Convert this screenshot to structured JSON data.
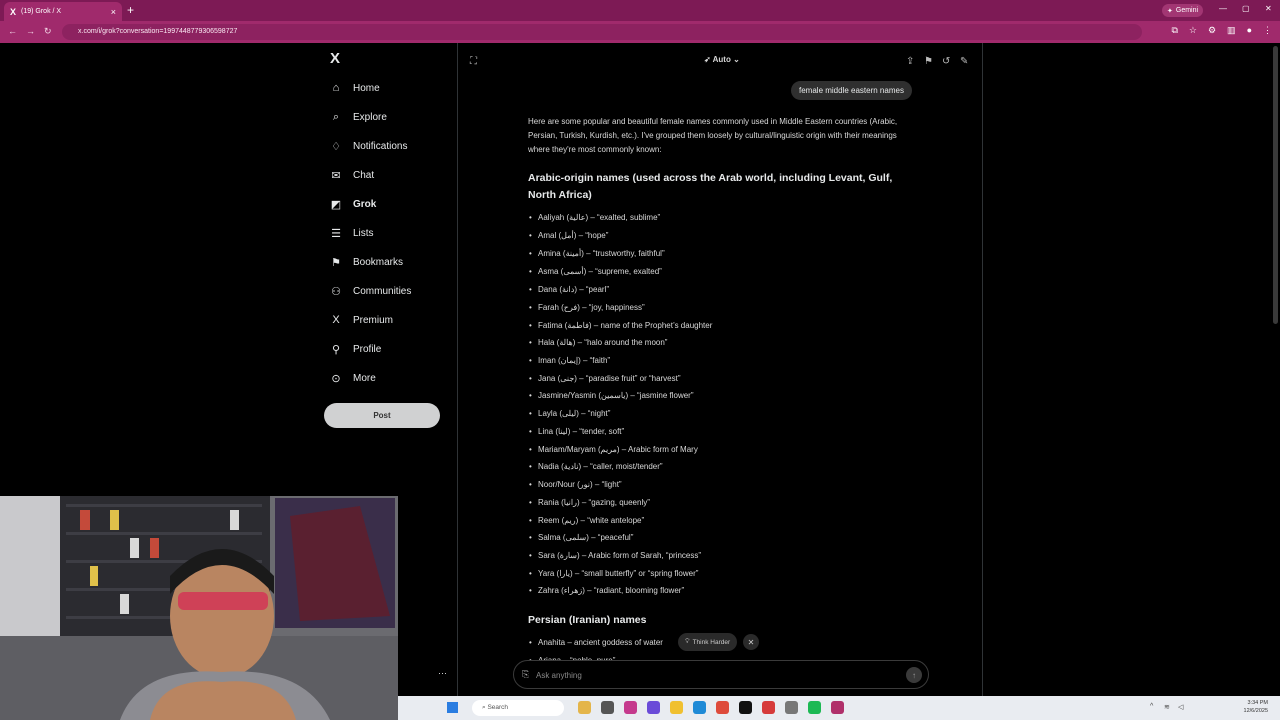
{
  "browser": {
    "tab_title": "(19) Grok / X",
    "tab_close": "×",
    "new_tab": "+",
    "gemini_label": "Gemini",
    "url": "x.com/i/grok?conversation=1997448779306598727"
  },
  "sidebar": {
    "items": [
      {
        "label": "Home",
        "icon": "home-icon",
        "glyph": "⌂"
      },
      {
        "label": "Explore",
        "icon": "search-icon",
        "glyph": "⌕"
      },
      {
        "label": "Notifications",
        "icon": "bell-icon",
        "glyph": "♢"
      },
      {
        "label": "Chat",
        "icon": "mail-icon",
        "glyph": "✉"
      },
      {
        "label": "Grok",
        "icon": "grok-icon",
        "glyph": "◩"
      },
      {
        "label": "Lists",
        "icon": "list-icon",
        "glyph": "☰"
      },
      {
        "label": "Bookmarks",
        "icon": "bookmark-icon",
        "glyph": "⚑"
      },
      {
        "label": "Communities",
        "icon": "people-icon",
        "glyph": "⚇"
      },
      {
        "label": "Premium",
        "icon": "x-icon",
        "glyph": "X"
      },
      {
        "label": "Profile",
        "icon": "person-icon",
        "glyph": "⚲"
      },
      {
        "label": "More",
        "icon": "more-circle-icon",
        "glyph": "⊙"
      }
    ],
    "post_label": "Post",
    "account_more": "···"
  },
  "grok": {
    "model_label": "Auto",
    "user_message": "female middle eastern names",
    "intro": "Here are some popular and beautiful female names commonly used in Middle Eastern countries (Arabic, Persian, Turkish, Kurdish, etc.). I've grouped them loosely by cultural/linguistic origin with their meanings where they're most commonly known:",
    "section1_title": "Arabic-origin names (used across the Arab world, including Levant, Gulf, North Africa)",
    "arabic_names": [
      "Aaliyah (عالية) – “exalted, sublime”",
      "Amal (أمل) – “hope”",
      "Amina (أمينة) – “trustworthy, faithful”",
      "Asma (أسمى) – “supreme, exalted”",
      "Dana (دانة) – “pearl”",
      "Farah (فرح) – “joy, happiness”",
      "Fatima (فاطمة) – name of the Prophet’s daughter",
      "Hala (هالة) – “halo around the moon”",
      "Iman (إيمان) – “faith”",
      "Jana (جنى) – “paradise fruit” or “harvest”",
      "Jasmine/Yasmin (ياسمين) – “jasmine flower”",
      "Layla (ليلى) – “night”",
      "Lina (لينا) – “tender, soft”",
      "Mariam/Maryam (مريم) – Arabic form of Mary",
      "Nadia (نادية) – “caller, moist/tender”",
      "Noor/Nour (نور) – “light”",
      "Rania (رانيا) – “gazing, queenly”",
      "Reem (ريم) – “white antelope”",
      "Salma (سلمى) – “peaceful”",
      "Sara (سارة) – Arabic form of Sarah, “princess”",
      "Yara (يارا) – “small butterfly” or “spring flower”",
      "Zahra (زهراء) – “radiant, blooming flower”"
    ],
    "section2_title": "Persian (Iranian) names",
    "persian_names": [
      "Anahita – ancient goddess of water",
      "Ariana – “noble, pure”"
    ],
    "think_harder_label": "Think Harder",
    "composer_placeholder": "Ask anything"
  },
  "taskbar": {
    "search_label": "Search",
    "time": "3:34 PM",
    "date": "12/6/2025"
  },
  "colors": {
    "browser_frame": "#a02a6c",
    "page_bg": "#000000",
    "text": "#e7e9ea"
  }
}
